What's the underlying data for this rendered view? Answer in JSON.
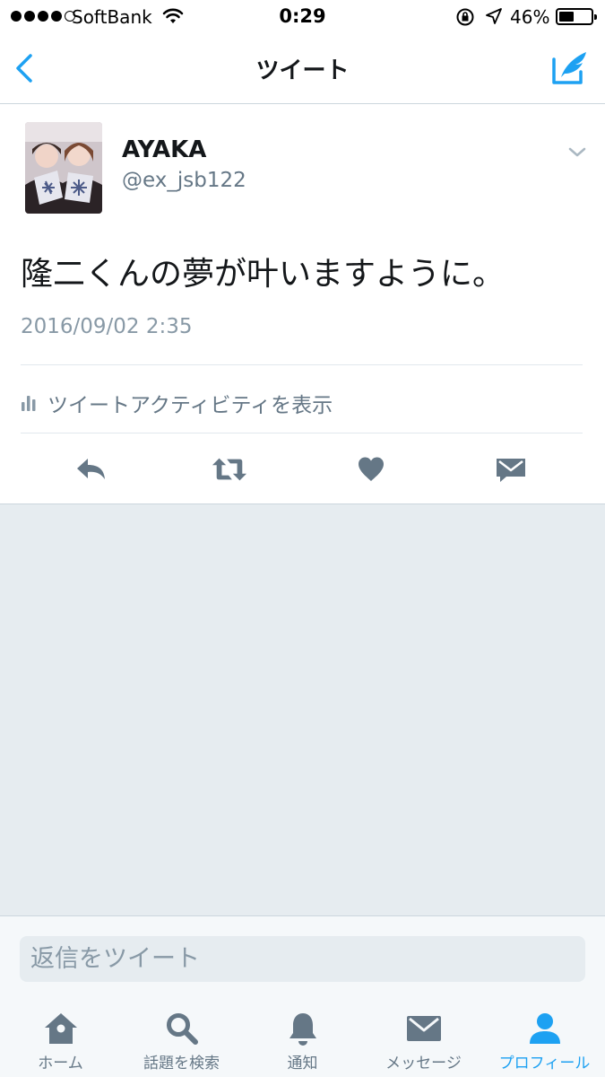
{
  "status_bar": {
    "carrier": "SoftBank",
    "time": "0:29",
    "battery_percent": "46%",
    "battery_level": 0.46,
    "signal_bars_filled": 4,
    "signal_bars_total": 5
  },
  "nav": {
    "title": "ツイート",
    "back_icon": "chevron-left-icon",
    "compose_icon": "compose-tweet-icon"
  },
  "tweet": {
    "author_name": "AYAKA",
    "author_handle": "@ex_jsb122",
    "text": "隆二くんの夢が叶いますように。",
    "timestamp": "2016/09/02 2:35",
    "activity_label": "ツイートアクティビティを表示",
    "actions": [
      "reply-icon",
      "retweet-icon",
      "like-icon",
      "direct-message-icon"
    ]
  },
  "reply": {
    "placeholder": "返信をツイート"
  },
  "tabs": [
    {
      "label": "ホーム",
      "icon": "home-icon",
      "active": false
    },
    {
      "label": "話題を検索",
      "icon": "search-icon",
      "active": false
    },
    {
      "label": "通知",
      "icon": "bell-icon",
      "active": false
    },
    {
      "label": "メッセージ",
      "icon": "envelope-icon",
      "active": false
    },
    {
      "label": "プロフィール",
      "icon": "profile-icon",
      "active": true
    }
  ],
  "colors": {
    "accent": "#1da1f2",
    "icon_gray": "#657786",
    "background_gray": "#e6ecf0",
    "text_dark": "#14171a"
  }
}
